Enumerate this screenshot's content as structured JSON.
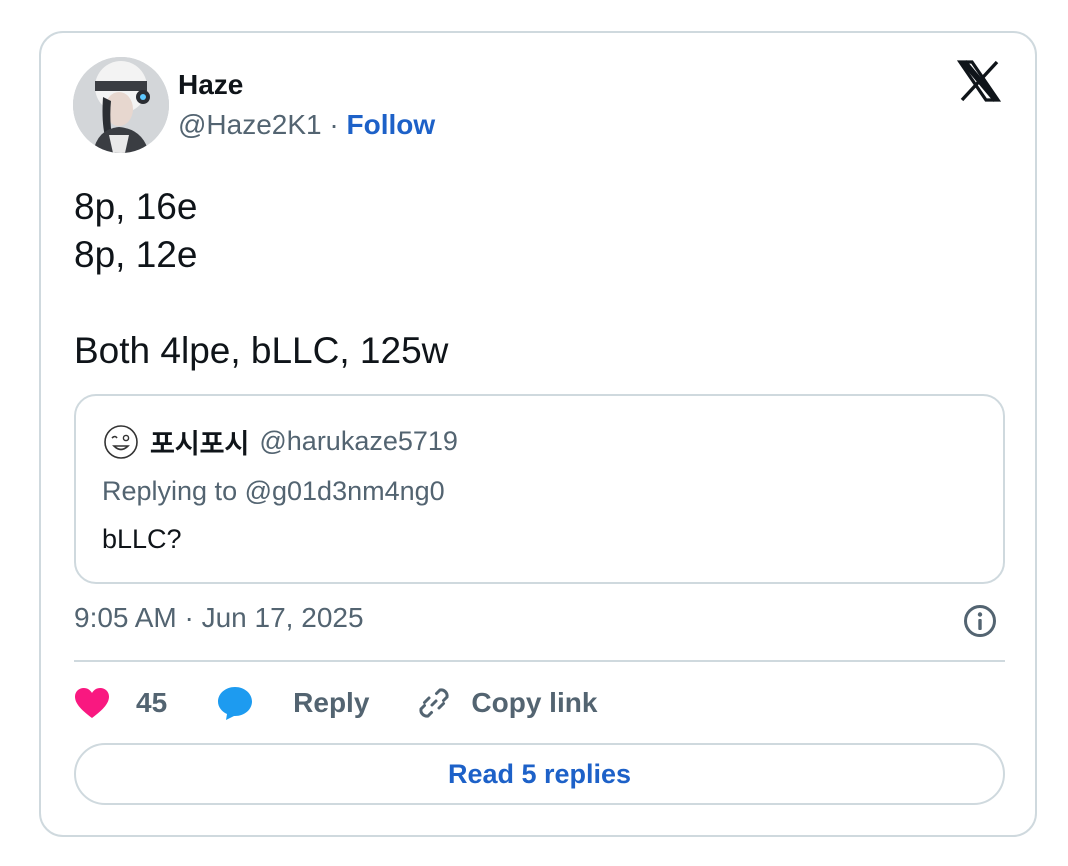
{
  "author": {
    "name": "Haze",
    "handle": "@Haze2K1",
    "separator": "·",
    "follow_label": "Follow"
  },
  "tweet": {
    "text": "8p, 16e\n8p, 12e\n\nBoth 4lpe, bLLC, 125w"
  },
  "quote": {
    "name": "포시포시",
    "handle": "@harukaze5719",
    "reply_prefix": "Replying to ",
    "reply_to": "@g01d3nm4ng0",
    "text": "bLLC?"
  },
  "meta": {
    "timestamp": "9:05 AM · Jun 17, 2025"
  },
  "actions": {
    "like_count": "45",
    "reply_label": "Reply",
    "copy_label": "Copy link"
  },
  "read_replies_label": "Read 5 replies",
  "colors": {
    "text": "#0f1419",
    "muted": "#536471",
    "link": "#1d61c8",
    "like": "#f91880",
    "reply_icon": "#1d9bf0",
    "border": "#cfd9de"
  },
  "icons": {
    "logo": "x-logo-icon",
    "like": "heart-icon",
    "reply": "speech-bubble-icon",
    "copy": "link-icon",
    "info": "info-icon"
  }
}
